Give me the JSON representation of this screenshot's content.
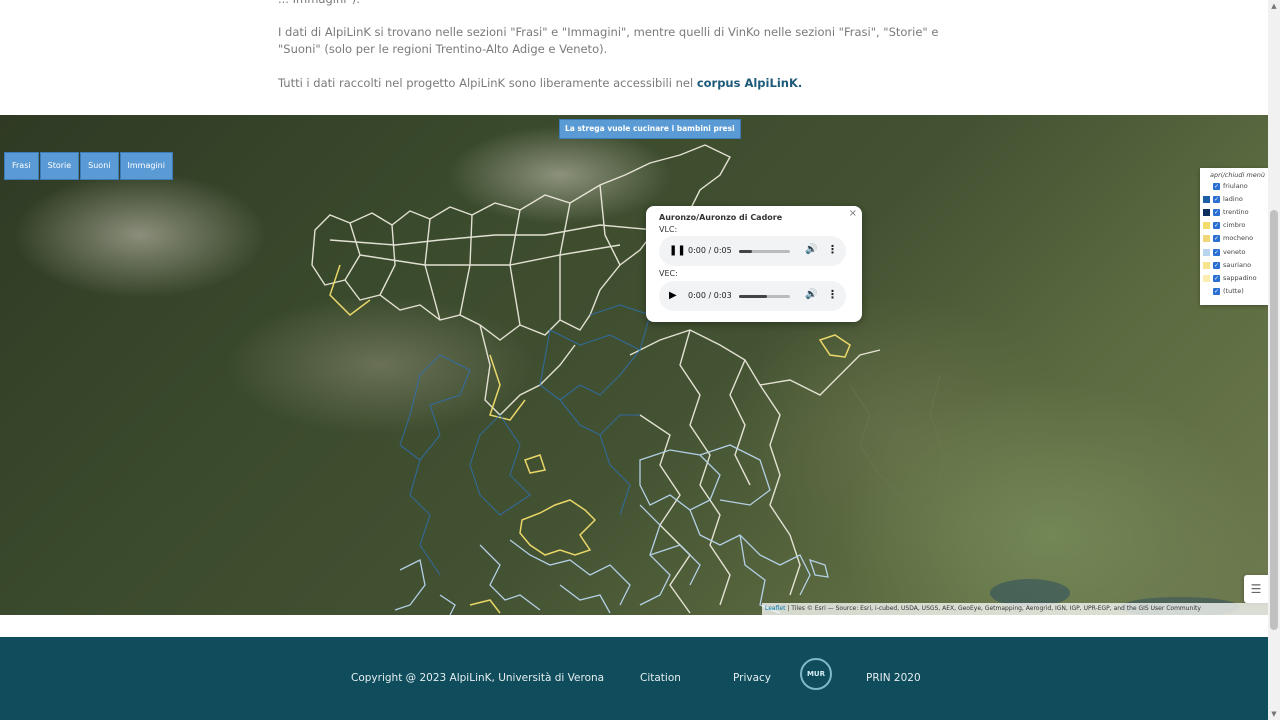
{
  "intro": {
    "line0": "... Immagini\").",
    "line1": "I dati di AlpiLinK si trovano nelle sezioni \"Frasi\" e \"Immagini\", mentre quelli di VinKo nelle sezioni \"Frasi\", \"Storie\" e \"Suoni\" (solo per le regioni Trentino-Alto Adige e Veneto).",
    "line2_prefix": "Tutti i dati raccolti nel progetto AlpiLinK sono liberamente accessibili nel ",
    "line2_link": "corpus AlpiLinK."
  },
  "map": {
    "title_button": "La strega vuole cucinare i bambini presi",
    "tabs": [
      "Frasi",
      "Storie",
      "Suoni",
      "Immagini"
    ],
    "popup": {
      "title": "Auronzo/Auronzo di Cadore",
      "close": "×",
      "recordings": [
        {
          "label": "VLC:",
          "time": "0:00 / 0:05",
          "state": "playing",
          "progress": 0.25
        },
        {
          "label": "VEC:",
          "time": "0:00 / 0:03",
          "state": "paused",
          "progress": 0.55
        }
      ]
    },
    "legend": {
      "title": "apri/chiudi menù",
      "items": [
        {
          "label": "friulano",
          "color": "#ffffff"
        },
        {
          "label": "ladino",
          "color": "#1d5fa6"
        },
        {
          "label": "trentino",
          "color": "#0e2f5e"
        },
        {
          "label": "cimbro",
          "color": "#f2dd6c"
        },
        {
          "label": "mocheno",
          "color": "#efd77a"
        },
        {
          "label": "veneto",
          "color": "#b9d6ee"
        },
        {
          "label": "sauriano",
          "color": "#f7e58d"
        },
        {
          "label": "sappadino",
          "color": "#fbeeb0"
        },
        {
          "label": "(tutte)",
          "color": ""
        }
      ]
    },
    "attribution": {
      "leaflet": "Leaflet",
      "text": " | Tiles © Esri — Source: Esri, i-cubed, USDA, USGS, AEX, GeoEye, Getmapping, Aerogrid, IGN, IGP, UPR-EGP, and the GIS User Community"
    },
    "colors": {
      "border_white": "#f4f1e4",
      "border_yellow": "#f2dd6c",
      "border_blue": "#2f6fb3",
      "border_lightblue": "#b9d6ee"
    }
  },
  "footer": {
    "copyright": "Copyright @ 2023 AlpiLinK, Università di Verona",
    "citation": "Citation",
    "privacy": "Privacy",
    "logo": "MUR",
    "prin": "PRIN 2020"
  }
}
